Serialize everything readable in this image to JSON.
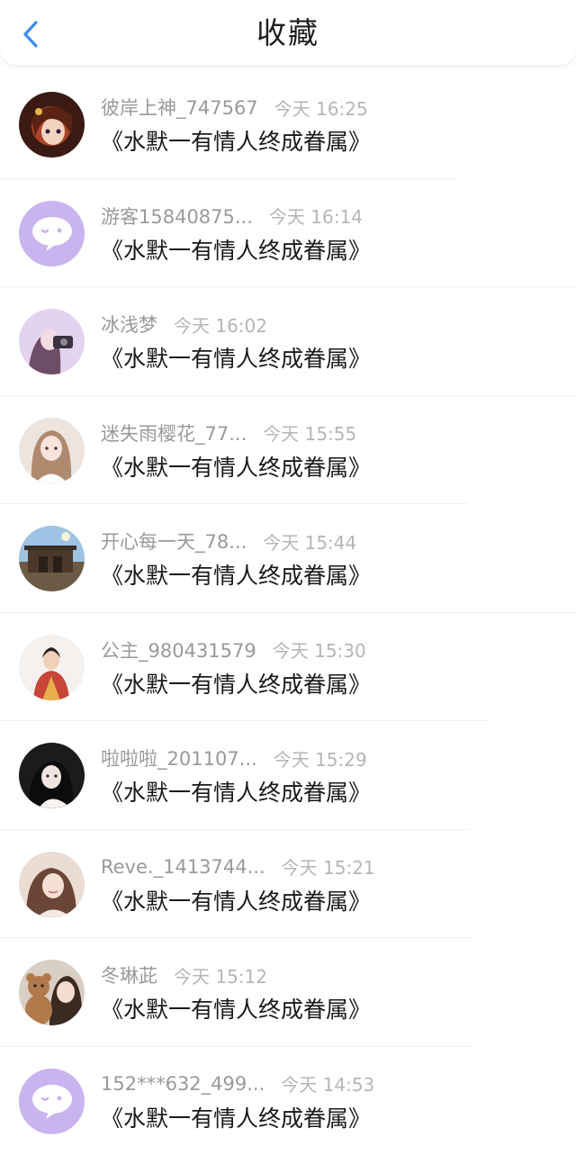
{
  "header": {
    "title": "收藏",
    "back_icon": "chevron-left-icon",
    "accent_color": "#3d8cf0"
  },
  "items": [
    {
      "name": "彼岸上神_747567",
      "time": "今天 16:25",
      "message": "《水默一有情人终成眷属》",
      "avatar": "anime-girl"
    },
    {
      "name": "游客15840875...",
      "time": "今天 16:14",
      "message": "《水默一有情人终成眷属》",
      "avatar": "default-chat-bubble"
    },
    {
      "name": "冰浅梦",
      "time": "今天 16:02",
      "message": "《水默一有情人终成眷属》",
      "avatar": "purple-girl"
    },
    {
      "name": "迷失雨樱花_77...",
      "time": "今天 15:55",
      "message": "《水默一有情人终成眷属》",
      "avatar": "light-girl"
    },
    {
      "name": "开心每一天_78...",
      "time": "今天 15:44",
      "message": "《水默一有情人终成眷属》",
      "avatar": "building-sky"
    },
    {
      "name": "公主_980431579",
      "time": "今天 15:30",
      "message": "《水默一有情人终成眷属》",
      "avatar": "red-dress-woman"
    },
    {
      "name": "啦啦啦_201107...",
      "time": "今天 15:29",
      "message": "《水默一有情人终成眷属》",
      "avatar": "dark-portrait"
    },
    {
      "name": "Reve._1413744...",
      "time": "今天 15:21",
      "message": "《水默一有情人终成眷属》",
      "avatar": "brown-hair-girl"
    },
    {
      "name": "冬琳茈",
      "time": "今天 15:12",
      "message": "《水默一有情人终成眷属》",
      "avatar": "teddy-bear-girl"
    },
    {
      "name": "152***632_499...",
      "time": "今天 14:53",
      "message": "《水默一有情人终成眷属》",
      "avatar": "default-chat-bubble"
    }
  ]
}
